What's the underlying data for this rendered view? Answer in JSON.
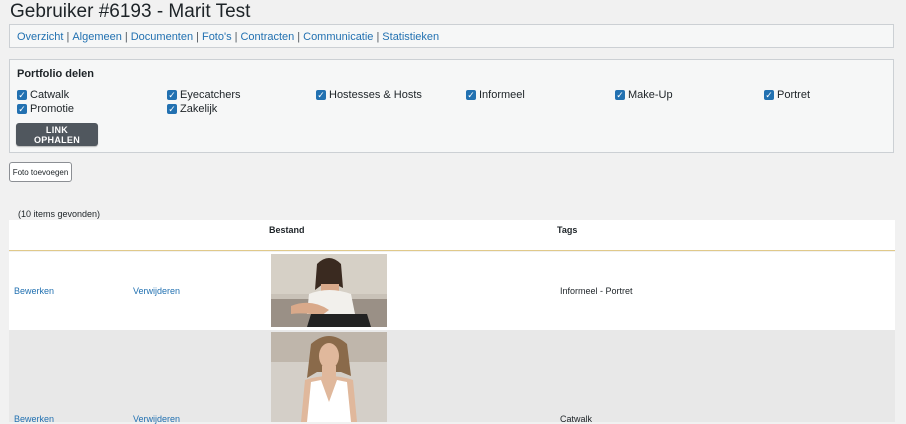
{
  "page": {
    "title": "Gebruiker #6193 - Marit Test"
  },
  "nav": {
    "items": [
      "Overzicht",
      "Algemeen",
      "Documenten",
      "Foto's",
      "Contracten",
      "Communicatie",
      "Statistieken"
    ],
    "separator": "|"
  },
  "portfolio": {
    "title": "Portfolio delen",
    "categories": [
      {
        "label": "Catwalk",
        "checked": true
      },
      {
        "label": "Eyecatchers",
        "checked": true
      },
      {
        "label": "Hostesses & Hosts",
        "checked": true
      },
      {
        "label": "Informeel",
        "checked": true
      },
      {
        "label": "Make-Up",
        "checked": true
      },
      {
        "label": "Portret",
        "checked": true
      },
      {
        "label": "Promotie",
        "checked": true
      },
      {
        "label": "Zakelijk",
        "checked": true
      }
    ],
    "button_label": "LINK OPHALEN"
  },
  "add_photo_label": "Foto toevoegen",
  "items_count": "(10 items gevonden)",
  "table": {
    "headers": {
      "file": "Bestand",
      "tags": "Tags"
    },
    "rows": [
      {
        "edit": "Bewerken",
        "delete": "Verwijderen",
        "tags": "Informeel - Portret"
      },
      {
        "edit": "Bewerken",
        "delete": "Verwijderen",
        "tags": "Catwalk"
      }
    ]
  },
  "colors": {
    "link": "#2271b1",
    "checkbox": "#2271b1",
    "primary_button": "#50575e",
    "header_border": "#e0c98a"
  }
}
